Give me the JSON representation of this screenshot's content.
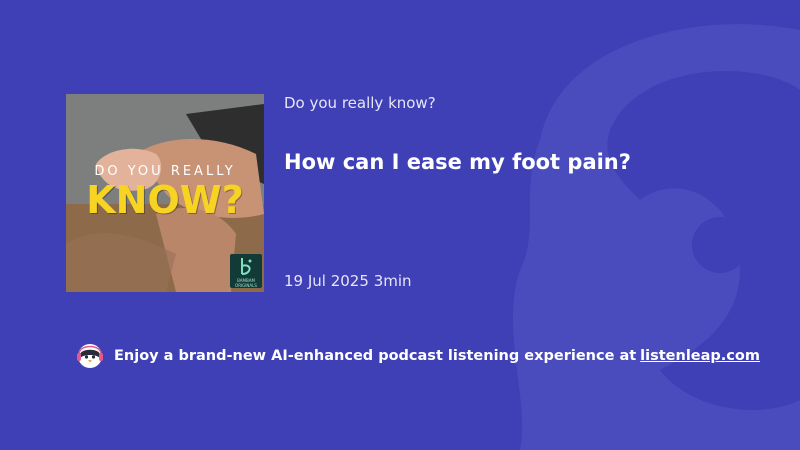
{
  "cover": {
    "title_line1": "DO YOU REALLY",
    "title_line2": "KNOW?",
    "badge_line1": "BAMBAM",
    "badge_line2": "ORIGINALS"
  },
  "podcast": {
    "name": "Do you really know?"
  },
  "episode": {
    "title": "How can I ease my foot pain?",
    "date": "19 Jul 2025",
    "duration": "3min"
  },
  "promo": {
    "text": "Enjoy a brand-new AI-enhanced podcast listening experience at",
    "link_text": "listenleap.com"
  },
  "colors": {
    "background": "#3f3fb6",
    "accent_yellow": "#f7d323",
    "text_light": "#e6e6f5"
  }
}
